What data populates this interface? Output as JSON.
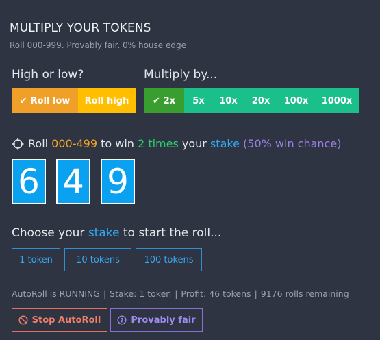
{
  "header": {
    "title": "MULTIPLY YOUR TOKENS",
    "subtitle": "Roll 000-999. Provably fair. 0% house edge"
  },
  "high_low": {
    "label": "High or low?",
    "options": [
      {
        "label": "Roll low",
        "selected": true,
        "color": "#f0a028"
      },
      {
        "label": "Roll high",
        "selected": false,
        "color": "#ffbf00"
      }
    ]
  },
  "multiply": {
    "label": "Multiply by...",
    "options": [
      {
        "label": "2x",
        "selected": true,
        "color": "#389e2f"
      },
      {
        "label": "5x",
        "selected": false,
        "color": "#1bbf8a"
      },
      {
        "label": "10x",
        "selected": false,
        "color": "#1bbf8a"
      },
      {
        "label": "20x",
        "selected": false,
        "color": "#1bbf8a"
      },
      {
        "label": "100x",
        "selected": false,
        "color": "#1bbf8a"
      },
      {
        "label": "1000x",
        "selected": false,
        "color": "#1bbf8a"
      }
    ]
  },
  "roll_summary": {
    "icon": "crosshair-icon",
    "prefix": "Roll",
    "range": "000-499",
    "to_win": "to win",
    "times": "2 times",
    "your": "your",
    "stake_word": "stake",
    "chance": "(50% win chance)"
  },
  "digits": [
    "6",
    "4",
    "9"
  ],
  "choose": {
    "prefix": "Choose your",
    "stake_word": "stake",
    "suffix": "to start the roll..."
  },
  "stakes": [
    "1 token",
    "10 tokens",
    "100 tokens"
  ],
  "status": {
    "autoroll": "AutoRoll is RUNNING",
    "stake": "Stake: 1 token",
    "profit": "Profit: 46 tokens",
    "remaining": "9176 rolls remaining",
    "separator": "|"
  },
  "actions": {
    "stop_label": "Stop AutoRoll",
    "stop_icon": "ban-icon",
    "fair_label": "Provably fair",
    "fair_icon": "question-circle-icon"
  }
}
